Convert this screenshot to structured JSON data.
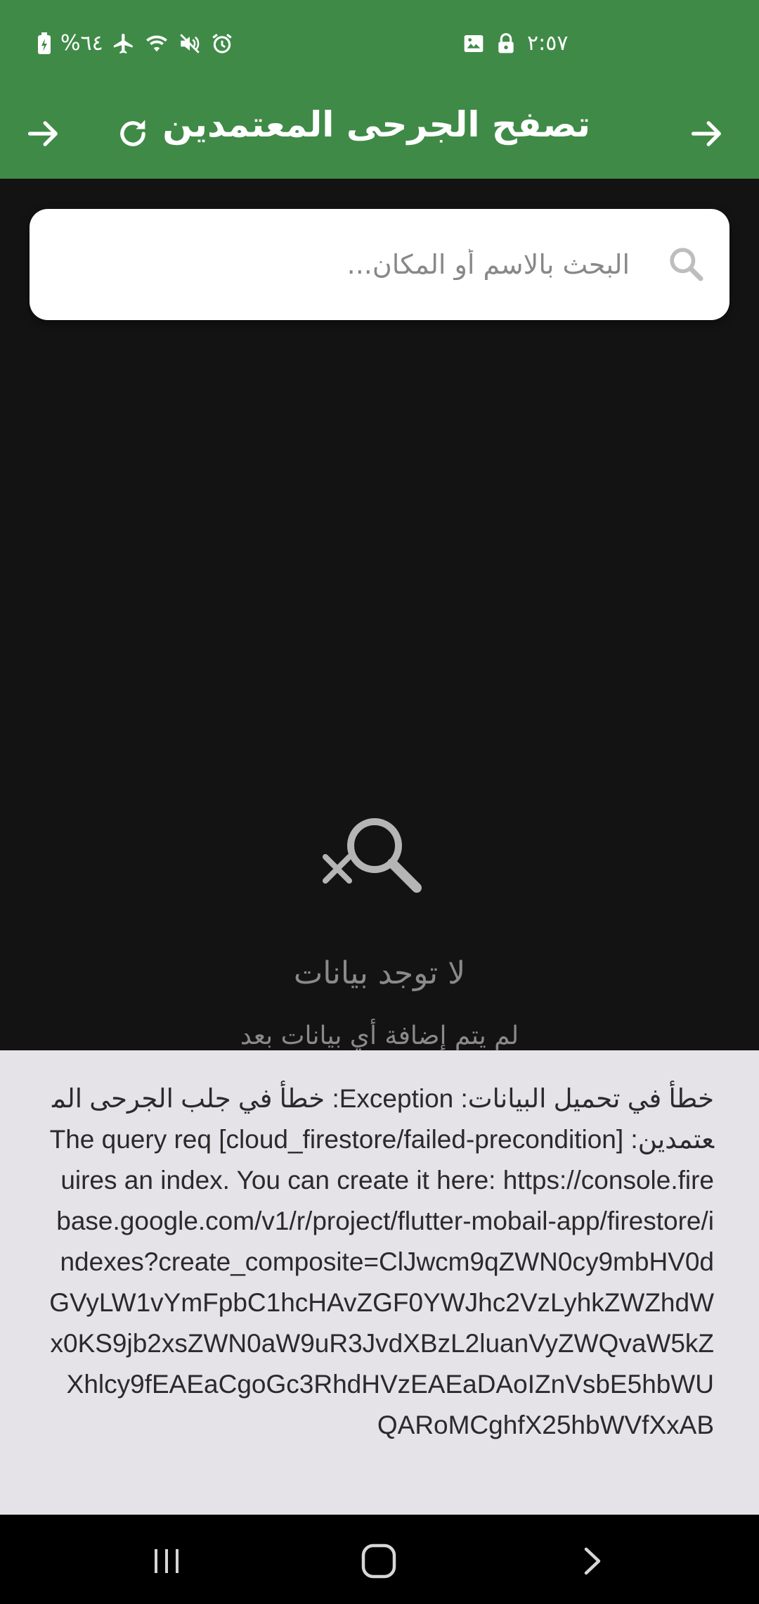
{
  "status_bar": {
    "time": "٢:٥٧",
    "battery": "%٦٤",
    "icons": [
      "image-icon",
      "lock-icon",
      "battery-icon",
      "airplane-icon",
      "wifi-icon",
      "mute-icon",
      "alarm-icon"
    ]
  },
  "app_bar": {
    "title": "تصفح الجرحى المعتمدين",
    "back_icon": "arrow-right-icon",
    "refresh_icon": "refresh-icon",
    "forward_icon": "arrow-right-icon"
  },
  "search": {
    "placeholder": "البحث بالاسم أو المكان...",
    "value": ""
  },
  "empty_state": {
    "icon": "search-off-icon",
    "title": "لا توجد بيانات",
    "subtitle": "لم يتم إضافة أي بيانات بعد"
  },
  "error": {
    "message": "خطأ في تحميل البيانات: Exception: خطأ في جلب الجرحى المعتمدين: [cloud_firestore/failed-precondition] The query requires an index. You can create it here: https://console.firebase.google.com/v1/r/project/flutter-mobail-app/firestore/indexes?create_composite=ClJwcm9qZWN0cy9mbHV0dGVyLW1vYmFpbC1hcHAvZGF0YWJhc2VzLyhkZWZhdWx0KS9jb2xsZWN0aW9uR3JvdXBzL2luanVyZWQvaW5kZXhlcy9fEAEaCgoGc3RhdHVzEAEaDAoIZnVsbE5hbWUQARoMCghfX25hbWVfXxAB"
  },
  "nav_bar": {
    "recents_icon": "recents-icon",
    "home_icon": "home-icon",
    "back_icon": "back-chevron-icon"
  },
  "colors": {
    "app_bar": "#3f8a47",
    "background": "#131313",
    "error_panel": "#e5e2e8"
  }
}
